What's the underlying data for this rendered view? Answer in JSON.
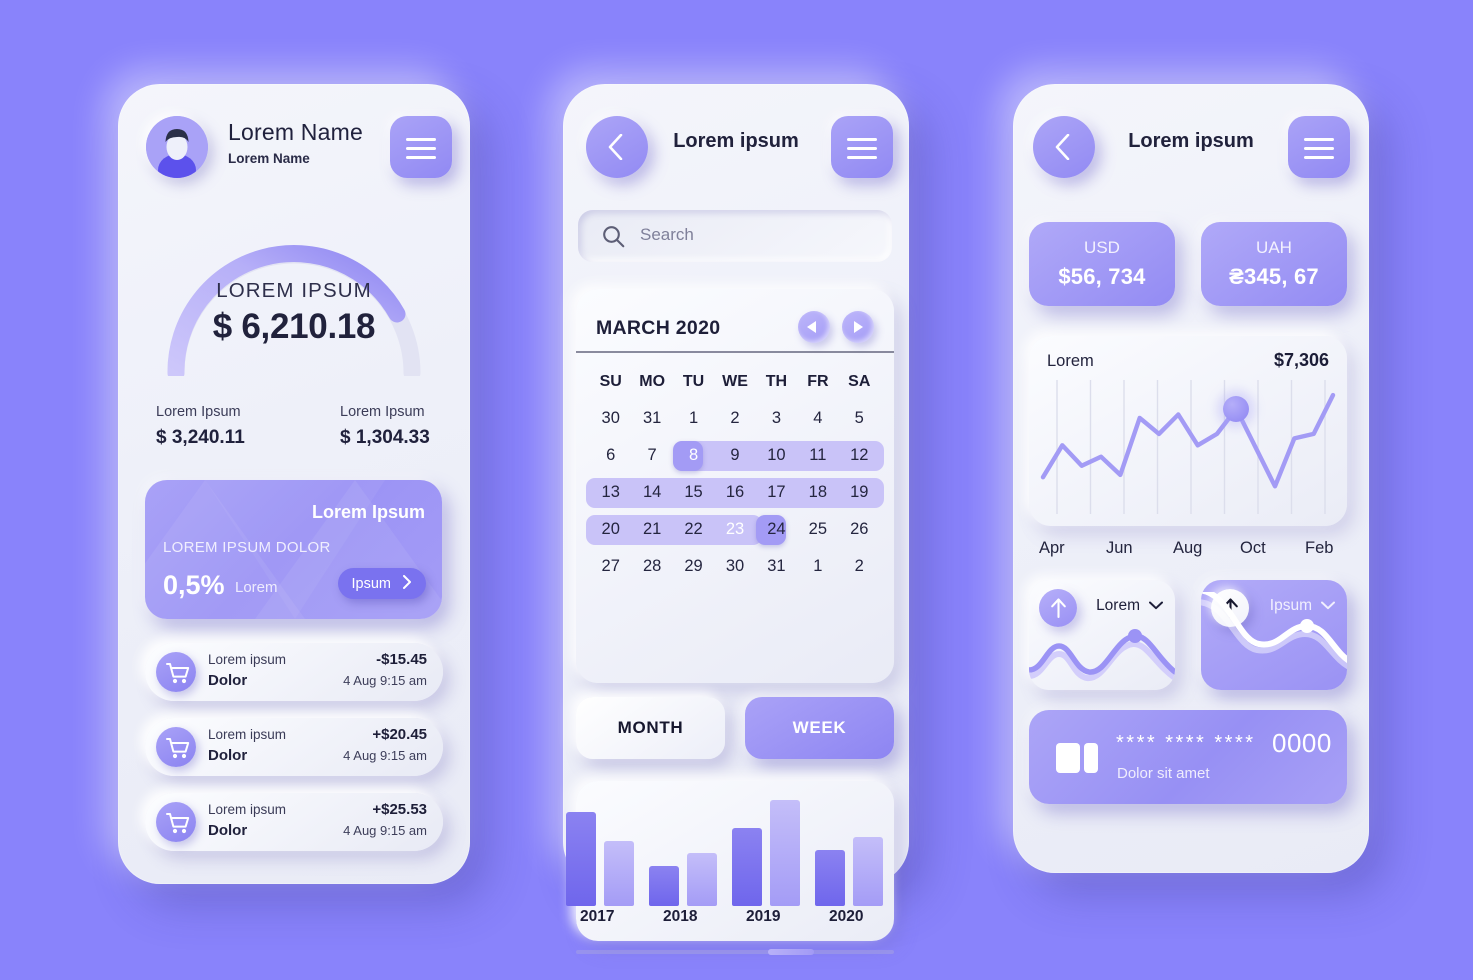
{
  "background_color": "#8983fb",
  "accent": {
    "purple": "#9990f4",
    "purple_dark": "#6f66ec",
    "purple_light": "#c9c3f8",
    "surface": "#eef0f9",
    "text_dark": "#21223c"
  },
  "screen1": {
    "header": {
      "name": "Lorem Name",
      "subtitle": "Lorem Name",
      "avatar_icon": "user-avatar-icon",
      "menu_icon": "hamburger-menu-icon"
    },
    "gauge": {
      "label": "LOREM IPSUM",
      "value": "$ 6,210.18",
      "percent": 78
    },
    "stats": [
      {
        "label": "Lorem Ipsum",
        "value": "$ 3,240.11"
      },
      {
        "label": "Lorem Ipsum",
        "value": "$ 1,304.33"
      }
    ],
    "promo": {
      "title": "Lorem Ipsum",
      "subtitle": "LOREM IPSUM DOLOR",
      "percent": "0,5%",
      "percent_note": "Lorem",
      "button_label": "Ipsum",
      "button_icon": "chevron-right-icon"
    },
    "transactions": [
      {
        "icon": "shopping-cart-icon",
        "title": "Lorem ipsum",
        "category": "Dolor",
        "amount": "-$15.45",
        "timestamp": "4 Aug  9:15 am"
      },
      {
        "icon": "shopping-cart-icon",
        "title": "Lorem ipsum",
        "category": "Dolor",
        "amount": "+$20.45",
        "timestamp": "4 Aug  9:15 am"
      },
      {
        "icon": "shopping-cart-icon",
        "title": "Lorem ipsum",
        "category": "Dolor",
        "amount": "+$25.53",
        "timestamp": "4 Aug  9:15 am"
      }
    ]
  },
  "screen2": {
    "header": {
      "title": "Lorem ipsum",
      "back_icon": "chevron-left-icon",
      "menu_icon": "hamburger-menu-icon"
    },
    "search": {
      "placeholder": "Search",
      "value": "",
      "icon": "search-icon"
    },
    "calendar": {
      "month_label": "MARCH 2020",
      "prev_icon": "triangle-left-icon",
      "next_icon": "triangle-right-icon",
      "weekdays": [
        "SU",
        "MO",
        "TU",
        "WE",
        "TH",
        "FR",
        "SA"
      ],
      "weeks": [
        [
          "30",
          "31",
          "1",
          "2",
          "3",
          "4",
          "5"
        ],
        [
          "6",
          "7",
          "8",
          "9",
          "10",
          "11",
          "12"
        ],
        [
          "13",
          "14",
          "15",
          "16",
          "17",
          "18",
          "19"
        ],
        [
          "20",
          "21",
          "22",
          "23",
          "24",
          "25",
          "26"
        ],
        [
          "27",
          "28",
          "29",
          "30",
          "31",
          "1",
          "2"
        ]
      ],
      "range_start": "8",
      "range_end": "23"
    },
    "segments": [
      {
        "label": "MONTH",
        "selected": false
      },
      {
        "label": "WEEK",
        "selected": true
      }
    ],
    "chart_data": {
      "type": "bar",
      "title": "",
      "xlabel": "",
      "ylabel": "",
      "categories": [
        "2017",
        "2018",
        "2019",
        "2020"
      ],
      "series": [
        {
          "name": "dark",
          "values": [
            96,
            41,
            79,
            57
          ]
        },
        {
          "name": "light",
          "values": [
            66,
            54,
            108,
            70
          ]
        }
      ],
      "ylim": [
        0,
        120
      ],
      "grid": false,
      "legend": "none"
    }
  },
  "screen3": {
    "header": {
      "title": "Lorem ipsum",
      "back_icon": "chevron-left-icon",
      "menu_icon": "hamburger-menu-icon"
    },
    "currencies": [
      {
        "code": "USD",
        "value": "$56, 734"
      },
      {
        "code": "UAH",
        "value": "₴345, 67"
      }
    ],
    "chart_data": {
      "type": "line",
      "title": "Lorem",
      "value_label": "$7,306",
      "xlabel": "",
      "ylabel": "",
      "tick_labels": [
        "Apr",
        "Jun",
        "Aug",
        "Oct",
        "Feb"
      ],
      "x": [
        0,
        1,
        2,
        3,
        4,
        5,
        6,
        7,
        8,
        9,
        10,
        11,
        12,
        13,
        14
      ],
      "values": [
        20,
        48,
        30,
        38,
        22,
        72,
        58,
        75,
        48,
        58,
        80,
        46,
        12,
        54,
        58,
        92
      ],
      "ylim": [
        0,
        100
      ],
      "grid": true,
      "highlight_index": 10,
      "highlight_label": "$7,306",
      "legend": "none"
    },
    "mini_cards": [
      {
        "label": "Lorem",
        "arrow_icon": "arrow-up-icon",
        "chevron_icon": "chevron-down-icon",
        "style": "light"
      },
      {
        "label": "Ipsum",
        "arrow_icon": "arrow-up-icon",
        "chevron_icon": "chevron-down-icon",
        "style": "purple"
      }
    ],
    "payment_card": {
      "chip_icon": "card-chip-icon",
      "masked_digits": "**** **** ****",
      "last_four": "0000",
      "holder": "Dolor sit amet"
    }
  }
}
